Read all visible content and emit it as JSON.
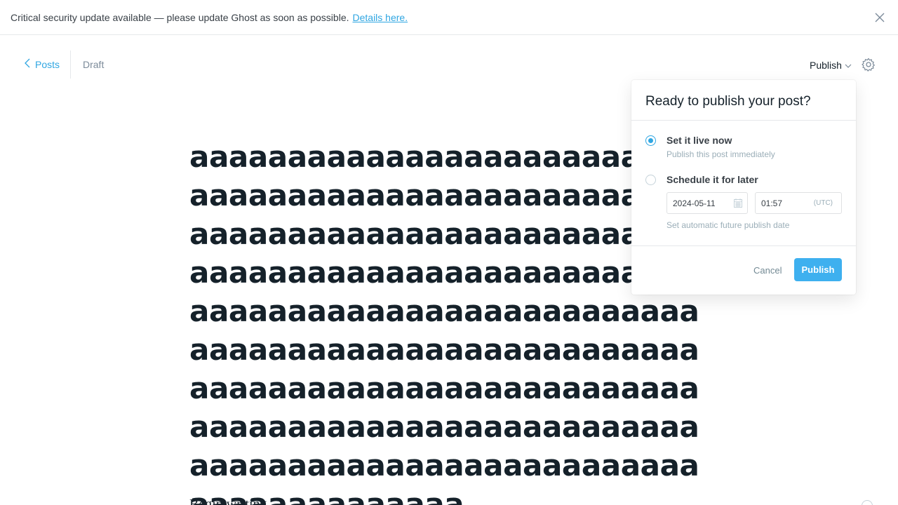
{
  "alert": {
    "message": "Critical security update available — please update Ghost as soon as possible.",
    "link_text": "Details here.",
    "close_icon": "close-icon"
  },
  "header": {
    "back_label": "Posts",
    "back_icon": "chevron-left-icon",
    "status": "Draft",
    "publish_label": "Publish",
    "publish_icon": "chevron-down-icon",
    "settings_icon": "gear-icon"
  },
  "post": {
    "title": "aaaaaaaaaaaaaaaaaaaaaaaaaaaaaaaaaaaaaaaaaaaaaaaaaaaaaaaaaaaaaaaaaaaaaaaaaaaaaaaaaaaaaaaaaaaaaaaaaaaaaaaaaaaaaaaaaaaaaaaaaaaaaaaaaaaaaaaaaaaaaaaaaaaaaaaaaaaaaaaaaaaaaaaaaaaaaaaaaaaaaaaaaaaaaaaaaaaaaaaaaaaaaaaaaaaaaaaaaaaaaaaaaaaaaaaaaaaaaaaaaaaaaaaa",
    "body_start": "Begin writing..."
  },
  "publish_popover": {
    "title": "Ready to publish your post?",
    "options": [
      {
        "label": "Set it live now",
        "description": "Publish this post immediately",
        "selected": true
      },
      {
        "label": "Schedule it for later",
        "description": "Set automatic future publish date",
        "selected": false
      }
    ],
    "date_value": "2024-05-11",
    "date_icon": "calendar-icon",
    "time_value": "01:57",
    "timezone": "(UTC)",
    "cancel_label": "Cancel",
    "publish_label": "Publish"
  },
  "colors": {
    "accent": "#3eb0ef",
    "link": "#2fa6e2"
  }
}
